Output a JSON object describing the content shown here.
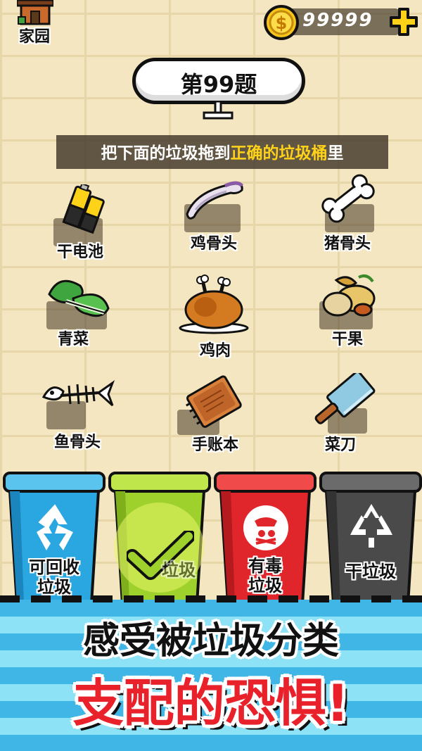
{
  "header": {
    "home_label": "家园",
    "coin_count": "99999",
    "add_coins_icon": "plus-icon"
  },
  "question": {
    "title": "第99题",
    "instruction_prefix": "把下面的垃圾拖到",
    "instruction_highlight": "正确的垃圾桶",
    "instruction_suffix": "里"
  },
  "items": [
    {
      "name": "干电池",
      "icon": "battery-icon"
    },
    {
      "name": "鸡骨头",
      "icon": "chicken-bone-icon"
    },
    {
      "name": "猪骨头",
      "icon": "pork-bone-icon"
    },
    {
      "name": "青菜",
      "icon": "green-vegetable-icon"
    },
    {
      "name": "鸡肉",
      "icon": "roast-chicken-icon"
    },
    {
      "name": "干果",
      "icon": "dried-fruit-icon"
    },
    {
      "name": "鱼骨头",
      "icon": "fish-bone-icon"
    },
    {
      "name": "手账本",
      "icon": "notebook-icon"
    },
    {
      "name": "菜刀",
      "icon": "kitchen-knife-icon"
    }
  ],
  "bins": [
    {
      "label_line1": "可回收",
      "label_line2": "垃圾",
      "color": "#2aa6e0",
      "icon": "recycle-icon"
    },
    {
      "label_line1": "",
      "label_line2": "垃圾",
      "color": "#9ed12c",
      "icon": "check-mark-icon"
    },
    {
      "label_line1": "有毒",
      "label_line2": "垃圾",
      "color": "#e0262b",
      "icon": "hazardous-icon"
    },
    {
      "label_line1": "干垃圾",
      "label_line2": "",
      "color": "#4a4a4a",
      "icon": "dry-waste-icon"
    }
  ],
  "slogan": {
    "line1": "感受被垃圾分类",
    "line2": "支配的恐惧!"
  },
  "colors": {
    "background": "#f3e6c0",
    "highlight": "#ffd21a",
    "slogan_red": "#e8212b",
    "stripe_blue": "#3fb6e6"
  }
}
